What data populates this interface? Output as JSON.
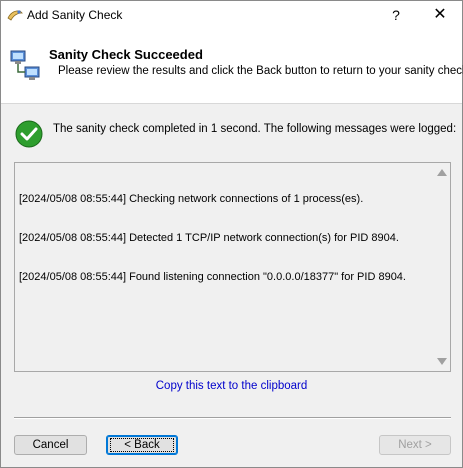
{
  "window": {
    "title": "Add Sanity Check",
    "help_label": "?",
    "close_label": "✕"
  },
  "header": {
    "title": "Sanity Check Succeeded",
    "subtitle": "Please review the results and click the Back button to return to your sanity check"
  },
  "result": {
    "message": "The sanity check completed in 1 second. The following messages were logged:"
  },
  "log": {
    "lines": [
      "[2024/05/08 08:55:44] Checking network connections of 1 process(es).",
      "[2024/05/08 08:55:44] Detected 1 TCP/IP network connection(s) for PID 8904.",
      "[2024/05/08 08:55:44] Found listening connection \"0.0.0.0/18377\" for PID 8904."
    ]
  },
  "copy_link": "Copy this text to the clipboard",
  "buttons": {
    "cancel": "Cancel",
    "back": "< Back",
    "next": "Next >"
  },
  "icons": {
    "app": "wizard-icon",
    "header": "network-computers-icon",
    "result": "success-check-icon"
  },
  "colors": {
    "link": "#0000cc",
    "success": "#2e9e2e",
    "focus_border": "#0078d7"
  }
}
